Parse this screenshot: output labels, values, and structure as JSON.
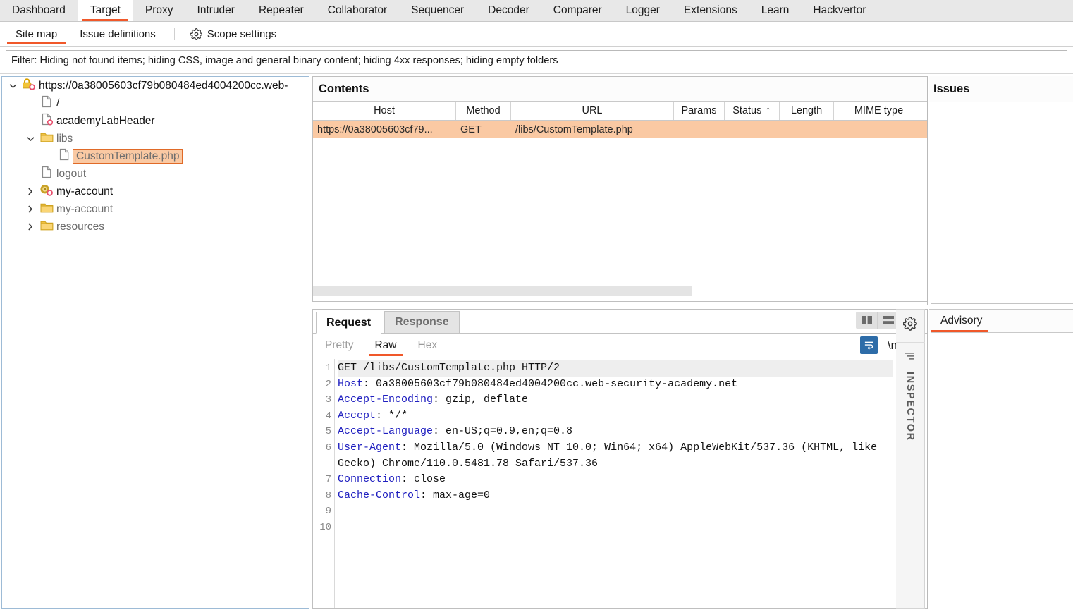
{
  "menubar": {
    "tabs": [
      {
        "label": "Dashboard",
        "active": false
      },
      {
        "label": "Target",
        "active": true
      },
      {
        "label": "Proxy",
        "active": false
      },
      {
        "label": "Intruder",
        "active": false
      },
      {
        "label": "Repeater",
        "active": false
      },
      {
        "label": "Collaborator",
        "active": false
      },
      {
        "label": "Sequencer",
        "active": false
      },
      {
        "label": "Decoder",
        "active": false
      },
      {
        "label": "Comparer",
        "active": false
      },
      {
        "label": "Logger",
        "active": false
      },
      {
        "label": "Extensions",
        "active": false
      },
      {
        "label": "Learn",
        "active": false
      },
      {
        "label": "Hackvertor",
        "active": false
      }
    ]
  },
  "subbar": {
    "tabs": [
      {
        "label": "Site map",
        "active": true
      },
      {
        "label": "Issue definitions",
        "active": false
      }
    ],
    "scope_settings_label": "Scope settings"
  },
  "filter": {
    "text": "Filter: Hiding not found items;  hiding CSS, image and general binary content;  hiding 4xx responses;  hiding empty folders"
  },
  "sitetree": {
    "nodes": [
      {
        "label": "https://0a38005603cf79b080484ed4004200cc.web-",
        "indent": 0,
        "twisty": "down",
        "icon": "lock-icon",
        "style": "normal"
      },
      {
        "label": "/",
        "indent": 1,
        "twisty": "none",
        "icon": "page-icon",
        "style": "normal"
      },
      {
        "label": "academyLabHeader",
        "indent": 1,
        "twisty": "none",
        "icon": "page-warning-icon",
        "style": "normal"
      },
      {
        "label": "libs",
        "indent": 1,
        "twisty": "down",
        "icon": "folder-icon",
        "style": "gray"
      },
      {
        "label": "CustomTemplate.php",
        "indent": 2,
        "twisty": "none",
        "icon": "page-icon",
        "style": "selected"
      },
      {
        "label": "logout",
        "indent": 1,
        "twisty": "none",
        "icon": "page-icon",
        "style": "gray"
      },
      {
        "label": "my-account",
        "indent": 1,
        "twisty": "right",
        "icon": "gear-warning-icon",
        "style": "normal"
      },
      {
        "label": "my-account",
        "indent": 1,
        "twisty": "right",
        "icon": "folder-icon",
        "style": "gray"
      },
      {
        "label": "resources",
        "indent": 1,
        "twisty": "right",
        "icon": "folder-icon",
        "style": "gray"
      }
    ]
  },
  "contents": {
    "title": "Contents",
    "columns": [
      {
        "label": "Host",
        "sorted": false
      },
      {
        "label": "Method",
        "sorted": false
      },
      {
        "label": "URL",
        "sorted": false
      },
      {
        "label": "Params",
        "sorted": false
      },
      {
        "label": "Status",
        "sorted": true,
        "caret": "⌃"
      },
      {
        "label": "Length",
        "sorted": false
      },
      {
        "label": "MIME type",
        "sorted": false
      }
    ],
    "rows": [
      {
        "host": "https://0a38005603cf79...",
        "method": "GET",
        "url": "/libs/CustomTemplate.php",
        "params": "",
        "status": "",
        "length": "",
        "mime": "",
        "selected": true
      }
    ]
  },
  "message_panel": {
    "tabs": [
      {
        "label": "Request",
        "active": true
      },
      {
        "label": "Response",
        "active": false
      }
    ],
    "view_tabs": [
      {
        "label": "Pretty",
        "active": false
      },
      {
        "label": "Raw",
        "active": true
      },
      {
        "label": "Hex",
        "active": false
      }
    ],
    "view_icons": {
      "wordwrap_label": "wrap-icon",
      "newline_label": "\\n",
      "menu_label": "burger-menu-icon"
    },
    "layout_toggles": [
      {
        "name": "side-by-side-layout",
        "selected": false
      },
      {
        "name": "stacked-layout",
        "selected": false
      },
      {
        "name": "single-pane-layout",
        "selected": true
      }
    ],
    "raw_lines": [
      {
        "n": "1",
        "highlight": true,
        "header": "",
        "text": "GET /libs/CustomTemplate.php HTTP/2"
      },
      {
        "n": "2",
        "highlight": false,
        "header": "Host",
        "text": ": 0a38005603cf79b080484ed4004200cc.web-security-academy.net"
      },
      {
        "n": "3",
        "highlight": false,
        "header": "Accept-Encoding",
        "text": ": gzip, deflate"
      },
      {
        "n": "4",
        "highlight": false,
        "header": "Accept",
        "text": ": */*"
      },
      {
        "n": "5",
        "highlight": false,
        "header": "Accept-Language",
        "text": ": en-US;q=0.9,en;q=0.8"
      },
      {
        "n": "6",
        "highlight": false,
        "header": "User-Agent",
        "text": ": Mozilla/5.0 (Windows NT 10.0; Win64; x64) AppleWebKit/537.36 (KHTML, like Gecko) Chrome/110.0.5481.78 Safari/537.36"
      },
      {
        "n": "7",
        "highlight": false,
        "header": "Connection",
        "text": ": close"
      },
      {
        "n": "8",
        "highlight": false,
        "header": "Cache-Control",
        "text": ": max-age=0"
      },
      {
        "n": "9",
        "highlight": false,
        "header": "",
        "text": ""
      },
      {
        "n": "10",
        "highlight": false,
        "header": "",
        "text": ""
      }
    ]
  },
  "inspector": {
    "label": "INSPECTOR"
  },
  "issues": {
    "title": "Issues"
  },
  "advisory": {
    "tab_label": "Advisory"
  },
  "colors": {
    "accent_orange": "#f0582a",
    "selection_peach": "#fac9a3",
    "selection_border": "#e06a28",
    "blue_toggle": "#2d6ca8",
    "header_blue": "#2020c0"
  }
}
